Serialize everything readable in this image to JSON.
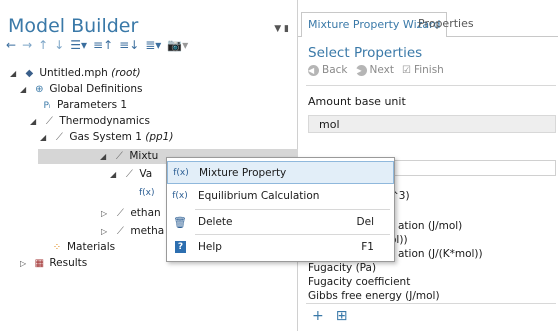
{
  "left_panel": {
    "title": "Model Builder",
    "controls": "▼ ▮",
    "toolbar": [
      "←",
      "→",
      "↑",
      "↓",
      "☰▾",
      "≡↑",
      "≡↓",
      "≣▾",
      "📷▾"
    ],
    "tree": [
      {
        "label": "Untitled.mph",
        "suffix": "(root)",
        "icon": "cube-icon",
        "arrow": "◢"
      },
      {
        "label": "Global Definitions",
        "icon": "globe-icon",
        "arrow": "◢"
      },
      {
        "label": "Parameters 1",
        "icon": "pi-icon",
        "glyph": "Pᵢ",
        "arrow": ""
      },
      {
        "label": "Thermodynamics",
        "icon": "thermo-icon",
        "arrow": "◢"
      },
      {
        "label": "Gas System 1",
        "suffix": "(pp1)",
        "icon": "thermo-icon",
        "arrow": "◢"
      },
      {
        "label": "Mixtu",
        "icon": "thermo-icon",
        "arrow": "◢"
      },
      {
        "label": "Va",
        "icon": "thermo-icon",
        "arrow": "◢"
      },
      {
        "label": "f(x)",
        "icon": "function-icon",
        "arrow": ""
      },
      {
        "label": "ethan",
        "icon": "thermo-icon",
        "arrow": "▷"
      },
      {
        "label": "metha",
        "icon": "thermo-icon",
        "arrow": "▷"
      },
      {
        "label": "Materials",
        "icon": "materials-icon",
        "arrow": ""
      },
      {
        "label": "Results",
        "icon": "results-icon",
        "arrow": "▷"
      }
    ]
  },
  "context_menu": {
    "items": [
      {
        "icon": "f(x)",
        "label": "Mixture Property",
        "shortcut": "",
        "highlighted": true
      },
      {
        "icon": "f(x)",
        "label": "Equilibrium Calculation",
        "shortcut": ""
      },
      {
        "icon": "🗑",
        "label": "Delete",
        "shortcut": "Del"
      },
      {
        "icon": "?",
        "label": "Help",
        "shortcut": "F1"
      }
    ]
  },
  "right_panel": {
    "tabs": [
      "Mixture Property Wizard",
      "Properties"
    ],
    "section_title": "Select Properties",
    "nav": {
      "back": "Back",
      "next": "Next",
      "finish": "Finish"
    },
    "amount_label": "Amount base unit",
    "amount_value": "mol",
    "list_items": [
      "^3)",
      "ation (J/mol)",
      "ol))",
      "ation (J/(K*mol))",
      "Fugacity (Pa)",
      "Fugacity coefficient",
      "Gibbs free energy (J/mol)"
    ],
    "bottom_tools": [
      "+",
      "⊞"
    ]
  }
}
